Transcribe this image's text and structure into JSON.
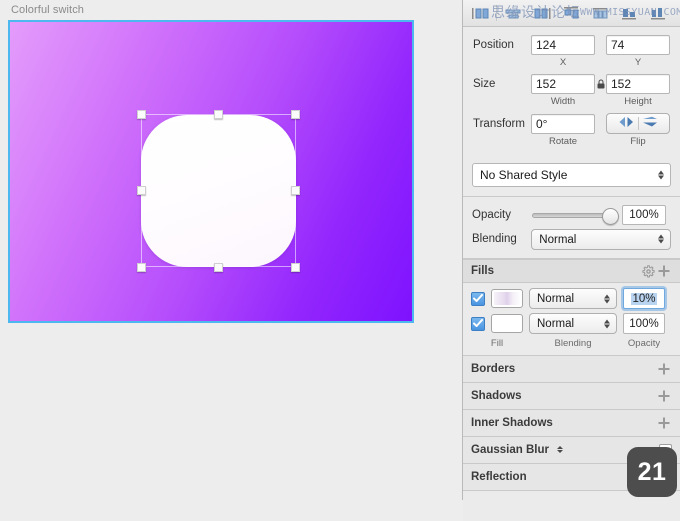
{
  "canvas": {
    "artboard_label": "Colorful switch",
    "gradient_from": "#e49cfb",
    "gradient_to": "#7e12fe",
    "selection_color": "#4db8f0",
    "shape_fill": "#ffffff"
  },
  "toolbar": {
    "icons": [
      "align-left-icon",
      "align-horizontal-center-icon",
      "align-right-icon",
      "align-top-icon",
      "distribute-horizontal-icon",
      "align-bottom-icon",
      "distribute-vertical-icon"
    ],
    "watermark_cn": "思缘设计论坛",
    "watermark_en": "WWW.MISSYUAN.COM"
  },
  "transform": {
    "position_label": "Position",
    "position_x": "124",
    "position_y": "74",
    "x_sub": "X",
    "y_sub": "Y",
    "size_label": "Size",
    "width": "152",
    "height": "152",
    "width_sub": "Width",
    "height_sub": "Height",
    "transform_label": "Transform",
    "rotate": "0°",
    "rotate_sub": "Rotate",
    "flip_sub": "Flip"
  },
  "shared_style": {
    "value": "No Shared Style"
  },
  "appearance": {
    "opacity_label": "Opacity",
    "opacity_value": "100%",
    "blending_label": "Blending",
    "blending_value": "Normal"
  },
  "fills": {
    "title": "Fills",
    "rows": [
      {
        "blending": "Normal",
        "opacity": "10%",
        "swatch": "gradient",
        "enabled": true,
        "focused": true
      },
      {
        "blending": "Normal",
        "opacity": "100%",
        "swatch": "white",
        "enabled": true,
        "focused": false
      }
    ],
    "footer": {
      "fill": "Fill",
      "blending": "Blending",
      "opacity": "Opacity"
    }
  },
  "sections": [
    {
      "title": "Borders",
      "control": "add"
    },
    {
      "title": "Shadows",
      "control": "add"
    },
    {
      "title": "Inner Shadows",
      "control": "add"
    },
    {
      "title": "Gaussian Blur",
      "control": "checkbox"
    },
    {
      "title": "Reflection",
      "control": "checkbox"
    }
  ],
  "badge": {
    "value": "21"
  }
}
